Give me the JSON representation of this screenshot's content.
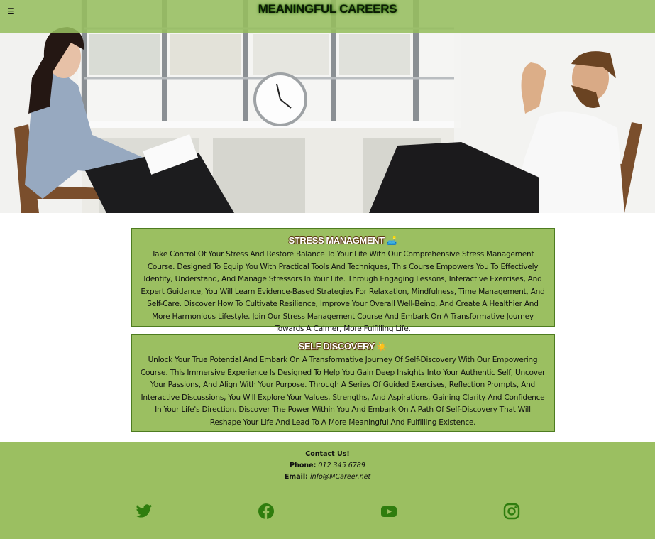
{
  "header": {
    "menu_icon": "☰",
    "title": "MEANINGFUL CAREERS"
  },
  "hero": {
    "image": "counseling-session-illustration"
  },
  "sections": [
    {
      "title": "STRESS MANAGMENT",
      "emoji": "🛋️",
      "body": "Take Control Of Your Stress And Restore Balance To Your Life With Our Comprehensive Stress Management Course. Designed To Equip You With Practical Tools And Techniques, This Course Empowers You To Effectively Identify, Understand, And Manage Stressors In Your Life. Through Engaging Lessons, Interactive Exercises, And Expert Guidance, You Will Learn Evidence-Based Strategies For Relaxation, Mindfulness, Time Management, And Self-Care. Discover How To Cultivate Resilience, Improve Your Overall Well-Being, And Create A Healthier And More Harmonious Lifestyle. Join Our Stress Management Course And Embark On A Transformative Journey Towards A Calmer, More Fulfilling Life."
    },
    {
      "title": "SELF DISCOVERY",
      "emoji": "☀️",
      "body": "Unlock Your True Potential And Embark On A Transformative Journey Of Self-Discovery With Our Empowering Course. This Immersive Experience Is Designed To Help You Gain Deep Insights Into Your Authentic Self, Uncover Your Passions, And Align With Your Purpose. Through A Series Of Guided Exercises, Reflection Prompts, And Interactive Discussions, You Will Explore Your Values, Strengths, And Aspirations, Gaining Clarity And Confidence In Your Life's Direction. Discover The Power Within You And Embark On A Path Of Self-Discovery That Will Reshape Your Life And Lead To A More Meaningful And Fulfilling Existence."
    }
  ],
  "footer": {
    "heading": "Contact Us!",
    "phone_label": "Phone:",
    "phone": "012 345 6789",
    "email_label": "Email:",
    "email": "info@MCareer.net",
    "social": [
      "twitter-icon",
      "facebook-icon",
      "youtube-icon",
      "instagram-icon"
    ]
  },
  "colors": {
    "accent": "#9bbf61",
    "accent_dark": "#4e7c20",
    "icon": "#2f7d0e"
  }
}
